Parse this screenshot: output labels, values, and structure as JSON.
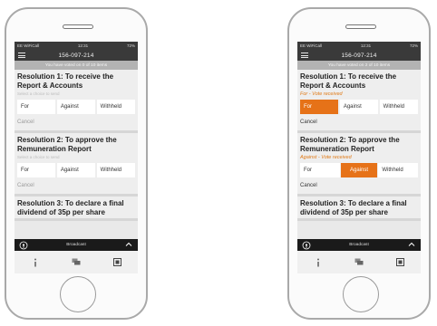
{
  "screens": [
    {
      "status": {
        "carrier": "EE WiFiCall",
        "time": "12:31",
        "battery": "72%"
      },
      "meeting_code": "156-097-214",
      "voted_text": "You have voted on 0 of 10 items",
      "resolutions": [
        {
          "title": "Resolution 1: To receive the Report & Accounts",
          "hint": "Select a choice to send",
          "status": "",
          "selected": "",
          "cancel": "Cancel"
        },
        {
          "title": "Resolution 2: To approve the Remuneration Report",
          "hint": "Select a choice to send",
          "status": "",
          "selected": "",
          "cancel": "Cancel"
        },
        {
          "title": "Resolution 3: To declare a final dividend of 35p per share",
          "hint": "",
          "status": "",
          "selected": "",
          "cancel": ""
        }
      ],
      "broadcast_label": "Broadcast"
    },
    {
      "status": {
        "carrier": "EE WiFiCall",
        "time": "12:31",
        "battery": "72%"
      },
      "meeting_code": "156-097-214",
      "voted_text": "You have voted on 2 of 10 items",
      "resolutions": [
        {
          "title": "Resolution 1: To receive the Report & Accounts",
          "hint": "",
          "status": "For - Vote received",
          "selected": "for",
          "cancel": "Cancel"
        },
        {
          "title": "Resolution 2: To approve the Remuneration Report",
          "hint": "",
          "status": "Against - Vote received",
          "selected": "against",
          "cancel": "Cancel"
        },
        {
          "title": "Resolution 3: To declare a final dividend of 35p per share",
          "hint": "",
          "status": "",
          "selected": "",
          "cancel": ""
        }
      ],
      "broadcast_label": "Broadcast"
    }
  ],
  "choice_labels": {
    "for": "For",
    "against": "Against",
    "withheld": "Withheld"
  },
  "colors": {
    "accent": "#e67218",
    "header": "#3a3a3a",
    "voted_bar": "#b3b3b3",
    "broadcast_bar": "#1a1a1a"
  },
  "icons": {
    "menu": "menu-icon",
    "broadcast": "podcast-icon",
    "expand": "chevron-up-icon",
    "tabs": [
      "info-icon",
      "chat-icon",
      "document-icon"
    ]
  }
}
